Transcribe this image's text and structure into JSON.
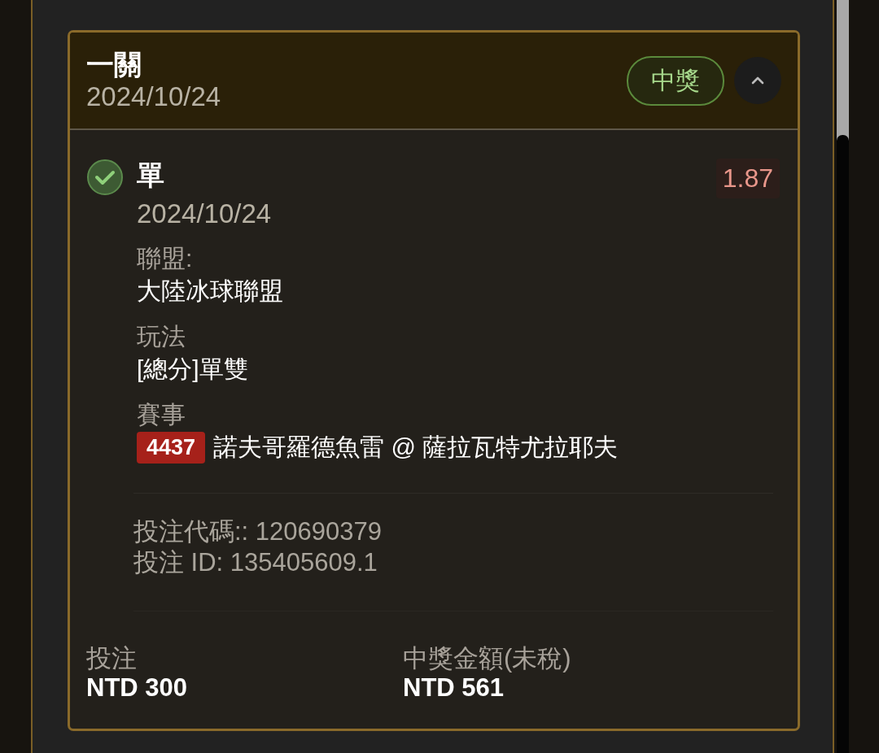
{
  "card": {
    "title": "一關",
    "date": "2024/10/24",
    "status": {
      "label": "中獎",
      "won": true
    },
    "expanded": true,
    "selection": {
      "won": true,
      "name": "單",
      "date": "2024/10/24",
      "odds": "1.87",
      "fields": [
        {
          "label": "聯盟:",
          "value": "大陸冰球聯盟"
        },
        {
          "label": "玩法",
          "value": "[總分]單雙"
        }
      ],
      "match": {
        "label": "賽事",
        "code": "4437",
        "teams": "諾夫哥羅德魚雷 @ 薩拉瓦特尤拉耶夫"
      },
      "bet_code": "投注代碼:: 120690379",
      "bet_id": "投注 ID: 135405609.1"
    },
    "totals": [
      {
        "label": "投注",
        "value": "NTD 300"
      },
      {
        "label": "中獎金額(未稅)",
        "value": "NTD 561"
      }
    ]
  }
}
